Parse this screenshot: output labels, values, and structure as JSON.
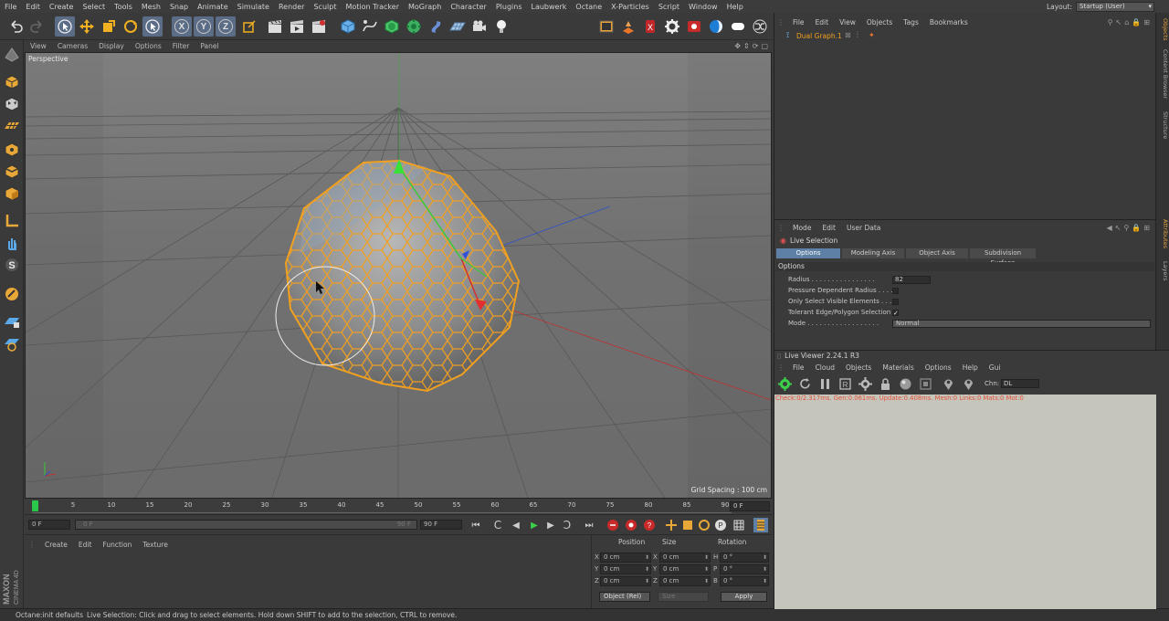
{
  "menubar": {
    "items": [
      "File",
      "Edit",
      "Create",
      "Select",
      "Tools",
      "Mesh",
      "Snap",
      "Animate",
      "Simulate",
      "Render",
      "Sculpt",
      "Motion Tracker",
      "MoGraph",
      "Character",
      "Plugins",
      "Laubwerk",
      "Octane",
      "X-Particles",
      "Script",
      "Window",
      "Help"
    ],
    "layout_label": "Layout:",
    "layout_value": "Startup (User)"
  },
  "viewport": {
    "menu": [
      "View",
      "Cameras",
      "Display",
      "Options",
      "Filter",
      "Panel"
    ],
    "label": "Perspective",
    "grid_spacing": "Grid Spacing : 100 cm"
  },
  "timeline": {
    "ticks": [
      "0",
      "5",
      "10",
      "15",
      "20",
      "25",
      "30",
      "35",
      "40",
      "45",
      "50",
      "55",
      "60",
      "65",
      "70",
      "75",
      "80",
      "85",
      "90"
    ],
    "end_field": "0 F",
    "start_field": "0 F",
    "range_start": "0 F",
    "range_end": "90 F",
    "max_field": "90 F"
  },
  "material_manager": {
    "menu": [
      "Create",
      "Edit",
      "Function",
      "Texture"
    ]
  },
  "coordinates": {
    "headers": [
      "Position",
      "Size",
      "Rotation"
    ],
    "rows": [
      {
        "pos_axis": "X",
        "pos": "0 cm",
        "size_axis": "X",
        "size": "0 cm",
        "rot_axis": "H",
        "rot": "0 °"
      },
      {
        "pos_axis": "Y",
        "pos": "0 cm",
        "size_axis": "Y",
        "size": "0 cm",
        "rot_axis": "P",
        "rot": "0 °"
      },
      {
        "pos_axis": "Z",
        "pos": "0 cm",
        "size_axis": "Z",
        "size": "0 cm",
        "rot_axis": "B",
        "rot": "0 °"
      }
    ],
    "mode": "Object (Rel)",
    "size_mode": "Size",
    "apply": "Apply"
  },
  "statusbar": {
    "left": "Octane:init defaults",
    "message": "Live Selection: Click and drag to select elements. Hold down SHIFT to add to the selection, CTRL to remove."
  },
  "object_manager": {
    "menu": [
      "File",
      "Edit",
      "View",
      "Objects",
      "Tags",
      "Bookmarks"
    ],
    "object_name": "Dual Graph.1"
  },
  "right_tabs": [
    "Objects",
    "Content Browser",
    "Structure",
    "Attributes",
    "Layers"
  ],
  "attribute_manager": {
    "menu": [
      "Mode",
      "Edit",
      "User Data"
    ],
    "tool_name": "Live Selection",
    "tabs": [
      "Options",
      "Modeling Axis",
      "Object Axis",
      "Subdivision Surface"
    ],
    "active_tab": 0,
    "section": "Options",
    "radius_label": "Radius . . . . . . . . . . . . . . . .",
    "radius_value": "82",
    "pressure_label": "Pressure Dependent Radius . . . .",
    "only_visible_label": "Only Select Visible Elements . . .",
    "tolerant_label": "Tolerant Edge/Polygon Selection",
    "tolerant_checked": "✓",
    "mode_label": "Mode . . . . . . . . . . . . . . . . . .",
    "mode_value": "Normal"
  },
  "live_viewer": {
    "title": "Live Viewer 2.24.1 R3",
    "menu": [
      "File",
      "Cloud",
      "Objects",
      "Materials",
      "Options",
      "Help",
      "Gui"
    ],
    "channel_label": "Chn:",
    "channel_value": "DL",
    "status": "Check:0/2.317ms. Gen:0.061ms. Update:0.408ms. Mesh:0 Links:0 Mats:0 Mot:0"
  },
  "colors": {
    "accent_orange": "#f0a020",
    "selection_blue": "#5e7fa6",
    "viewport_bg": "#6f6f6f"
  }
}
